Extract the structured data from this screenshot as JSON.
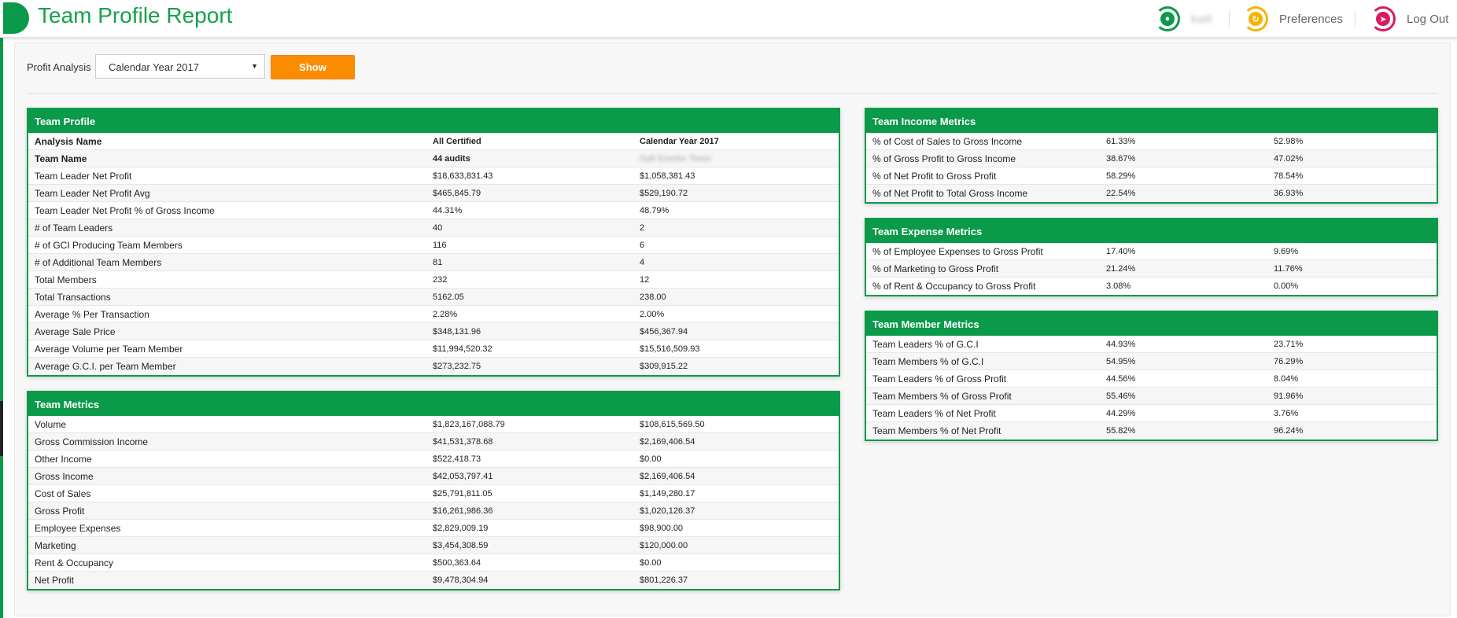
{
  "header": {
    "title": "Team Profile Report",
    "user_name": "kaitl",
    "preferences_label": "Preferences",
    "logout_label": "Log Out"
  },
  "filter": {
    "label": "Profit Analysis",
    "selected": "Calendar Year 2017",
    "show_label": "Show"
  },
  "team_profile": {
    "title": "Team Profile",
    "rows": [
      {
        "label": "Analysis Name",
        "all": "All Certified",
        "year": "Calendar Year 2017",
        "bold": true
      },
      {
        "label": "Team Name",
        "all": "44 audits",
        "year": "Salt Exeder Team",
        "bold": true
      },
      {
        "label": "Team Leader Net Profit",
        "all": "$18,633,831.43",
        "year": "$1,058,381.43"
      },
      {
        "label": "Team Leader Net Profit Avg",
        "all": "$465,845.79",
        "year": "$529,190.72"
      },
      {
        "label": "Team Leader Net Profit % of Gross Income",
        "all": "44.31%",
        "year": "48.79%"
      },
      {
        "label": "# of Team Leaders",
        "all": "40",
        "year": "2"
      },
      {
        "label": "# of GCI Producing Team Members",
        "all": "116",
        "year": "6"
      },
      {
        "label": "# of Additional Team Members",
        "all": "81",
        "year": "4"
      },
      {
        "label": "Total Members",
        "all": "232",
        "year": "12"
      },
      {
        "label": "Total Transactions",
        "all": "5162.05",
        "year": "238.00"
      },
      {
        "label": "Average % Per Transaction",
        "all": "2.28%",
        "year": "2.00%"
      },
      {
        "label": "Average Sale Price",
        "all": "$348,131.96",
        "year": "$456,367.94"
      },
      {
        "label": "Average Volume per Team Member",
        "all": "$11,994,520.32",
        "year": "$15,516,509.93"
      },
      {
        "label": "Average G.C.I. per Team Member",
        "all": "$273,232.75",
        "year": "$309,915.22"
      }
    ]
  },
  "team_metrics": {
    "title": "Team Metrics",
    "rows": [
      {
        "label": "Volume",
        "all": "$1,823,167,088.79",
        "year": "$108,615,569.50"
      },
      {
        "label": "Gross Commission Income",
        "all": "$41,531,378.68",
        "year": "$2,169,406.54"
      },
      {
        "label": "Other Income",
        "all": "$522,418.73",
        "year": "$0.00"
      },
      {
        "label": "Gross Income",
        "all": "$42,053,797.41",
        "year": "$2,169,406.54"
      },
      {
        "label": "Cost of Sales",
        "all": "$25,791,811.05",
        "year": "$1,149,280.17"
      },
      {
        "label": "Gross Profit",
        "all": "$16,261,986.36",
        "year": "$1,020,126.37"
      },
      {
        "label": "Employee Expenses",
        "all": "$2,829,009.19",
        "year": "$98,900.00"
      },
      {
        "label": "Marketing",
        "all": "$3,454,308.59",
        "year": "$120,000.00"
      },
      {
        "label": "Rent & Occupancy",
        "all": "$500,363.64",
        "year": "$0.00"
      },
      {
        "label": "Net Profit",
        "all": "$9,478,304.94",
        "year": "$801,226.37"
      }
    ]
  },
  "income_metrics": {
    "title": "Team Income Metrics",
    "rows": [
      {
        "label": "% of Cost of Sales to Gross Income",
        "all": "61.33%",
        "year": "52.98%"
      },
      {
        "label": "% of Gross Profit to Gross Income",
        "all": "38.67%",
        "year": "47.02%"
      },
      {
        "label": "% of Net Profit to Gross Profit",
        "all": "58.29%",
        "year": "78.54%"
      },
      {
        "label": "% of Net Profit to Total Gross Income",
        "all": "22.54%",
        "year": "36.93%"
      }
    ]
  },
  "expense_metrics": {
    "title": "Team Expense Metrics",
    "rows": [
      {
        "label": "% of Employee Expenses to Gross Profit",
        "all": "17.40%",
        "year": "9.69%"
      },
      {
        "label": "% of Marketing to Gross Profit",
        "all": "21.24%",
        "year": "11.76%"
      },
      {
        "label": "% of Rent & Occupancy to Gross Profit",
        "all": "3.08%",
        "year": "0.00%"
      }
    ]
  },
  "member_metrics": {
    "title": "Team Member Metrics",
    "rows": [
      {
        "label": "Team Leaders % of G.C.I",
        "all": "44.93%",
        "year": "23.71%"
      },
      {
        "label": "Team Members % of G.C.I",
        "all": "54.95%",
        "year": "76.29%"
      },
      {
        "label": "Team Leaders % of Gross Profit",
        "all": "44.56%",
        "year": "8.04%"
      },
      {
        "label": "Team Members % of Gross Profit",
        "all": "55.46%",
        "year": "91.96%"
      },
      {
        "label": "Team Leaders % of Net Profit",
        "all": "44.29%",
        "year": "3.76%"
      },
      {
        "label": "Team Members % of Net Profit",
        "all": "55.82%",
        "year": "96.24%"
      }
    ]
  }
}
